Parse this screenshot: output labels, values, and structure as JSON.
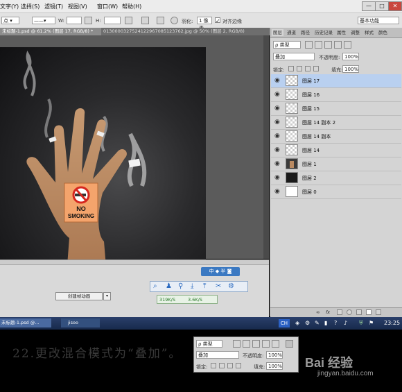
{
  "menubar": {
    "items": [
      "文字(Y)",
      "选择(S)",
      "滤镜(T)",
      "视图(V)",
      "窗口(W)",
      "帮助(H)"
    ],
    "controls": [
      "—",
      "□",
      "✕"
    ]
  },
  "options": {
    "w_label": "W:",
    "h_label": "H:",
    "feather_label": "羽化:",
    "feather_value": "1 像素",
    "antialias_label": "对齐边缘",
    "workspace_value": "基本功能"
  },
  "doc_tabs": [
    {
      "label": "未标题-1.psd @ 61.2% (图层 17, RGB/8) *"
    },
    {
      "label": "0130000327524122967085123762.jpg @ 50% (图层 2, RGB/8)"
    }
  ],
  "photo": {
    "sign_text_line1": "NO",
    "sign_text_line2": "SMOKING"
  },
  "timeline": {
    "create_button": "创建帧动画",
    "ime_label": "中 ◆ 半 ◙",
    "download_speed": "319K/S",
    "upload_speed": "3.6K/S"
  },
  "panel": {
    "tabs": [
      "图层",
      "通道",
      "路径",
      "历史记录",
      "属性",
      "调整",
      "样式",
      "颜色"
    ],
    "filter_label": "ρ 类型",
    "blend_mode": "叠加",
    "opacity_label": "不透明度:",
    "opacity_value": "100%",
    "lock_label": "锁定:",
    "fill_label": "填充:",
    "fill_value": "100%",
    "layers": [
      {
        "name": "图层 17",
        "selected": true,
        "thumb": "transparent"
      },
      {
        "name": "图层 16",
        "selected": false,
        "thumb": "transparent"
      },
      {
        "name": "图层 15",
        "selected": false,
        "thumb": "transparent"
      },
      {
        "name": "图层 14 副本 2",
        "selected": false,
        "thumb": "transparent"
      },
      {
        "name": "图层 14 副本",
        "selected": false,
        "thumb": "transparent"
      },
      {
        "name": "图层 14",
        "selected": false,
        "thumb": "transparent"
      },
      {
        "name": "图层 1",
        "selected": false,
        "thumb": "hand"
      },
      {
        "name": "图层 2",
        "selected": false,
        "thumb": "dark"
      },
      {
        "name": "图层 0",
        "selected": false,
        "thumb": "white"
      }
    ]
  },
  "taskbar": {
    "items": [
      "未标题-1.psd @...",
      "jisoo"
    ],
    "lang": "CH",
    "clock": "23:25"
  },
  "caption": {
    "text": "22.更改混合模式为“叠加”。",
    "watermark_brand": "Bai 经验",
    "watermark_url": "jingyan.baidu.com"
  },
  "inset": {
    "filter_label": "ρ 类型",
    "blend_mode": "叠加",
    "opacity_label": "不透明度:",
    "opacity_value": "100%",
    "lock_label": "锁定:",
    "fill_label": "填充:",
    "fill_value": "100%"
  }
}
